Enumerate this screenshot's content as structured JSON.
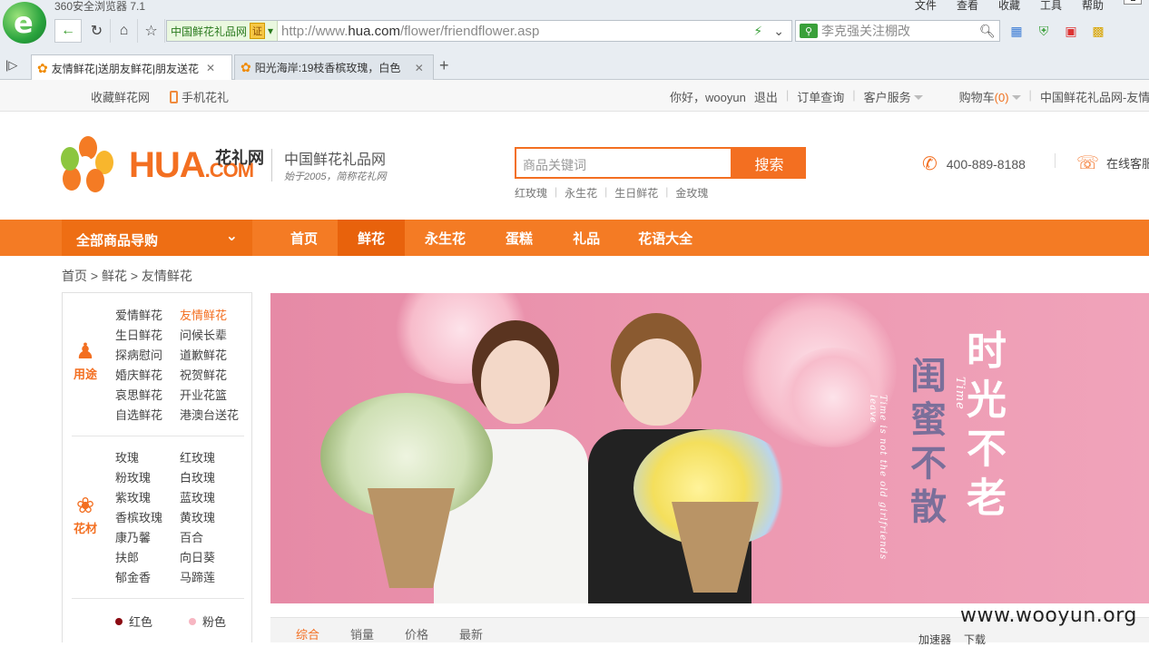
{
  "browser": {
    "title": "360安全浏览器 7.1",
    "menu": [
      "文件",
      "查看",
      "收藏",
      "工具",
      "帮助"
    ],
    "site_badge": "中国鲜花礼品网",
    "cert_badge": "证",
    "url_prefix": "http://www.",
    "url_domain": "hua.com",
    "url_path": "/flower/friendflower.asp",
    "search_placeholder": "李克强关注棚改",
    "tabs": [
      {
        "title": "友情鲜花|送朋友鲜花|朋友送花"
      },
      {
        "title": "阳光海岸:19枝香槟玫瑰，白色"
      }
    ]
  },
  "topbar": {
    "left": [
      "收藏鲜花网",
      "手机花礼"
    ],
    "greeting": "你好，wooyun",
    "logout": "退出",
    "order_query": "订单查询",
    "customer_service": "客户服务",
    "cart_label": "购物车",
    "cart_count": "(0)",
    "site_link": "中国鲜花礼品网-友情鲜花"
  },
  "header": {
    "logo_hua": "HUA",
    "logo_com": ".COM",
    "logo_cn": "花礼网",
    "slogan1": "中国鲜花礼品网",
    "slogan2": "始于2005，简称花礼网",
    "search_placeholder": "商品关键词",
    "search_button": "搜索",
    "hot_words": [
      "红玫瑰",
      "永生花",
      "生日鲜花",
      "金玫瑰"
    ],
    "hotline": "400-889-8188",
    "service": "在线客服"
  },
  "nav": {
    "all_categories": "全部商品导购",
    "items": [
      "首页",
      "鲜花",
      "永生花",
      "蛋糕",
      "礼品",
      "花语大全"
    ],
    "current": "鲜花"
  },
  "breadcrumb": "首页 > 鲜花 > 友情鲜花",
  "sidebar": {
    "purpose_label": "用途",
    "purpose": [
      "爱情鲜花",
      "友情鲜花",
      "生日鲜花",
      "问候长辈",
      "探病慰问",
      "道歉鲜花",
      "婚庆鲜花",
      "祝贺鲜花",
      "哀思鲜花",
      "开业花篮",
      "自选鲜花",
      "港澳台送花"
    ],
    "purpose_active": "友情鲜花",
    "material_label": "花材",
    "material": [
      "玫瑰",
      "红玫瑰",
      "粉玫瑰",
      "白玫瑰",
      "紫玫瑰",
      "蓝玫瑰",
      "香槟玫瑰",
      "黄玫瑰",
      "康乃馨",
      "百合",
      "扶郎",
      "向日葵",
      "郁金香",
      "马蹄莲"
    ],
    "colors": [
      {
        "name": "红色",
        "color": "#8b0a12"
      },
      {
        "name": "粉色",
        "color": "#f7b6c2"
      }
    ]
  },
  "banner": {
    "line1": "时光不老",
    "line2": "闺蜜不散",
    "en_time": "Time",
    "en_text": "Time is not the old girlfriends leave"
  },
  "sort": [
    "综合",
    "销量",
    "价格",
    "最新"
  ],
  "status": {
    "items": [
      "加速器",
      "下载"
    ]
  },
  "watermark": "www.wooyun.org",
  "colors": {
    "brand_orange": "#f36f21",
    "nav_orange": "#f47b24",
    "banner_pink": "#ec97b0"
  }
}
